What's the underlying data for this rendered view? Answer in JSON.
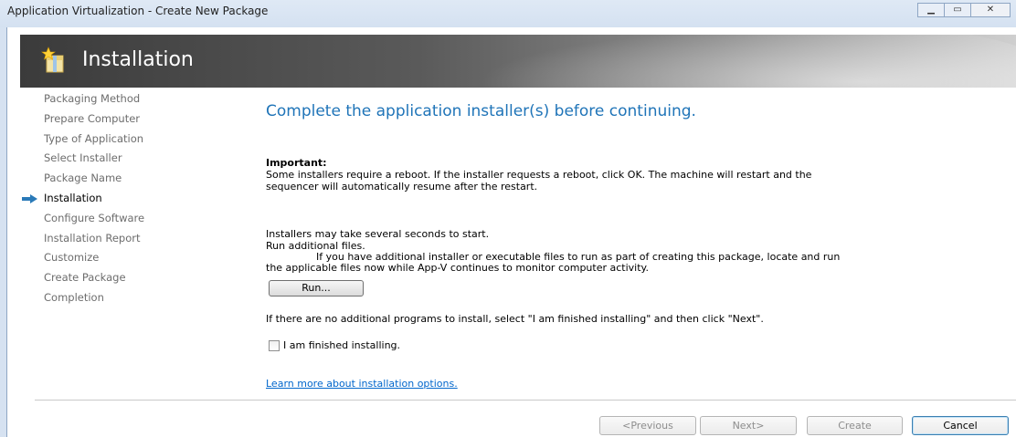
{
  "window": {
    "title": "Application Virtualization - Create New Package"
  },
  "header": {
    "title": "Installation",
    "icon": "package-star-icon"
  },
  "nav": {
    "items": [
      {
        "label": "Packaging Method"
      },
      {
        "label": "Prepare Computer"
      },
      {
        "label": "Type of Application"
      },
      {
        "label": "Select Installer"
      },
      {
        "label": "Package Name"
      },
      {
        "label": "Installation"
      },
      {
        "label": "Configure Software"
      },
      {
        "label": "Installation Report"
      },
      {
        "label": "Customize"
      },
      {
        "label": "Create Package"
      },
      {
        "label": "Completion"
      }
    ],
    "active_index": 5
  },
  "main": {
    "heading": "Complete the application installer(s) before continuing.",
    "important_label": "Important:",
    "important_text_1": "Some installers require a reboot. If the installer requests a reboot, click OK. The machine will restart and the",
    "important_text_2": "sequencer will automatically resume after the restart.",
    "wait_text": "Installers may take several seconds to start.",
    "run_additional_title": "Run additional files.",
    "run_additional_text_1": "If you have additional installer or executable files to run as part of creating this package, locate and run",
    "run_additional_text_2": "the applicable files now while App-V continues to monitor computer activity.",
    "run_button": "Run...",
    "finish_instruction": "If there are no additional programs to install, select \"I am finished installing\" and then click \"Next\".",
    "finished_checkbox_label": "I am finished installing.",
    "finished_checked": false,
    "learn_more_link": "Learn more about installation options."
  },
  "footer": {
    "previous": "<Previous",
    "next": "Next>",
    "create": "Create",
    "cancel": "Cancel"
  },
  "colors": {
    "heading": "#1f74b8",
    "link": "#0066cc",
    "active_arrow": "#2a7ab8"
  }
}
